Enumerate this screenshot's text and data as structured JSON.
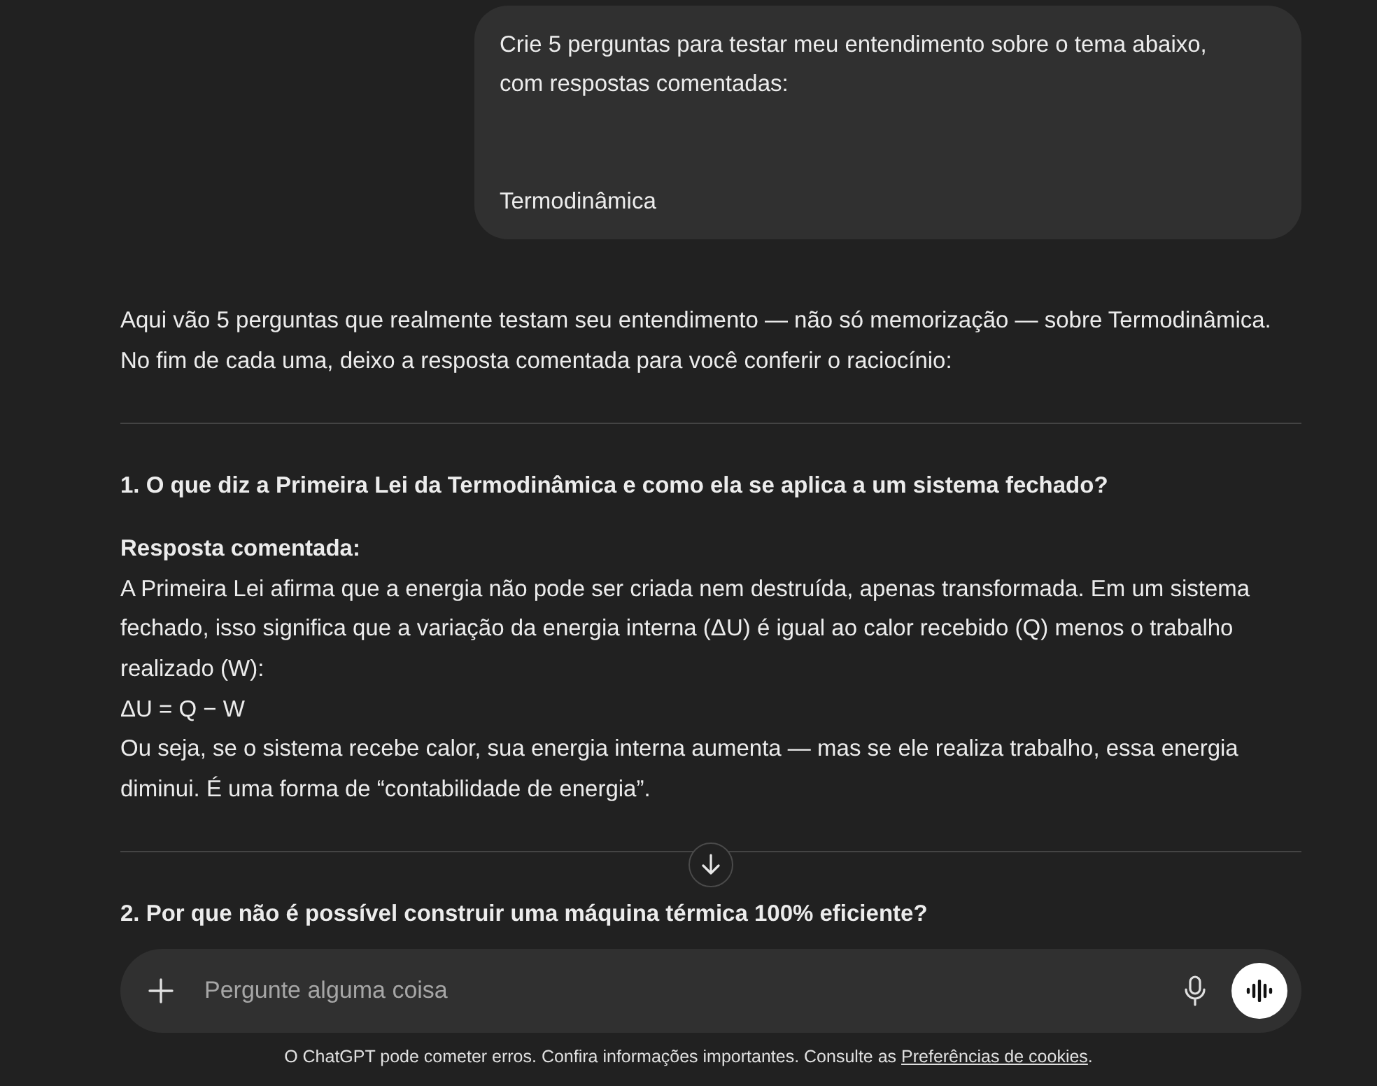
{
  "user_message": {
    "text": "Crie 5 perguntas para testar meu entendimento sobre o tema abaixo,\ncom respostas comentadas:\n\n\nTermodinâmica"
  },
  "assistant": {
    "intro": "Aqui vão 5 perguntas que realmente testam seu entendimento — não só memorização — sobre Termodinâmica. No fim de cada uma, deixo a resposta comentada para você conferir o raciocínio:",
    "questions": [
      {
        "heading": "1. O que diz a Primeira Lei da Termodinâmica e como ela se aplica a um sistema fechado?",
        "answer_label": "Resposta comentada:",
        "answer_lines": [
          "A Primeira Lei afirma que a energia não pode ser criada nem destruída, apenas transformada. Em um sistema fechado, isso significa que a variação da energia interna (ΔU) é igual ao calor recebido (Q) menos o trabalho realizado (W):",
          "ΔU = Q − W",
          "Ou seja, se o sistema recebe calor, sua energia interna aumenta — mas se ele realiza trabalho, essa energia diminui. É uma forma de “contabilidade de energia”."
        ]
      },
      {
        "heading": "2. Por que não é possível construir uma máquina térmica 100% eficiente?"
      }
    ]
  },
  "composer": {
    "placeholder": "Pergunte alguma coisa"
  },
  "footer": {
    "text": "O ChatGPT pode cometer erros. Confira informações importantes. Consulte as ",
    "link": "Preferências de cookies",
    "end": "."
  }
}
